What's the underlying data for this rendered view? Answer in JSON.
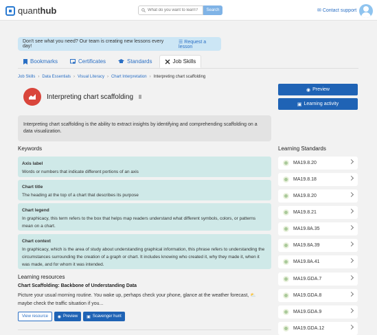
{
  "header": {
    "logo_prefix": "quant",
    "logo_bold": "hub",
    "search_placeholder": "What do you want to learn?",
    "search_button": "Search",
    "contact_label": "Contact support"
  },
  "notice": {
    "text": "Don't see what you need? Our team is creating new lessons every day!",
    "link": "Request a lesson"
  },
  "tabs": [
    {
      "label": "Bookmarks",
      "icon": "bookmark-icon"
    },
    {
      "label": "Certificates",
      "icon": "certificate-icon"
    },
    {
      "label": "Standards",
      "icon": "graduation-cap-icon"
    },
    {
      "label": "Job Skills",
      "icon": "tools-icon",
      "active": true
    }
  ],
  "breadcrumb": [
    "Job Skills",
    "Data Essentials",
    "Visual Literacy",
    "Chart Interpretation",
    "Interpreting chart scaffolding"
  ],
  "page": {
    "title": "Interpreting chart scaffolding",
    "description": "Interpreting chart scaffolding is the ability to extract insights by identifying and comprehending scaffolding on a data visualization.",
    "preview_label": "Preview",
    "learning_activity_label": "Learning activity"
  },
  "keywords": {
    "heading": "Keywords",
    "items": [
      {
        "name": "Axis label",
        "text": "Words or numbers that indicate different portions of an axis"
      },
      {
        "name": "Chart title",
        "text": "The heading at the top of a chart that describes its purpose"
      },
      {
        "name": "Chart legend",
        "text": "In graphicacy, this term refers to the box that helps map readers understand what different symbols, colors, or patterns mean on a chart."
      },
      {
        "name": "Chart context",
        "text": "In graphicacy, which is the area of study about understanding graphical information, this phrase refers to understanding the circumstances surrounding the creation of a graph or chart. It includes knowing who created it, why they made it, when it was made, and for whom it was intended."
      }
    ]
  },
  "resources": {
    "heading": "Learning resources",
    "title": "Chart Scaffolding: Backbone of Understanding Data",
    "text": "Picture your usual morning routine. You wake up, perhaps check your phone, glance at the weather forecast, ⛅ maybe check the traffic situation if you...",
    "view_label": "View resource",
    "preview_label": "Preview",
    "hunt_label": "Scavenger hunt"
  },
  "standards": {
    "heading": "Learning Standards",
    "items": [
      "MA19.8.20",
      "MA19.8.18",
      "MA19.8.20",
      "MA19.8.21",
      "MA19.8A.35",
      "MA19.8A.39",
      "MA19.8A.41",
      "MA19.GDA.7",
      "MA19.GDA.8",
      "MA19.GDA.9",
      "MA19.GDA.12"
    ]
  }
}
